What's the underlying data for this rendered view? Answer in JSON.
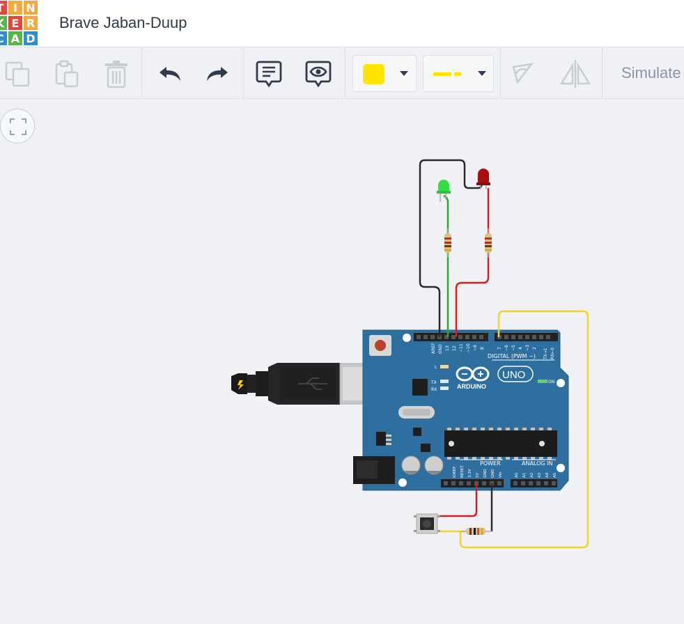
{
  "app": {
    "logo_letters": [
      "T",
      "I",
      "N",
      "K",
      "E",
      "R",
      "C",
      "A",
      "D"
    ],
    "logo_colors": [
      "#e8443a",
      "#f7a83b",
      "#f7a83b",
      "#58b847",
      "#e8443a",
      "#f7a83b",
      "#2c90d0",
      "#58b847",
      "#2c90d0"
    ],
    "project_title": "Brave Jaban-Duup"
  },
  "toolbar": {
    "copy_icon": "copy-icon",
    "paste_icon": "paste-icon",
    "delete_icon": "trash-icon",
    "undo_icon": "undo-icon",
    "redo_icon": "redo-icon",
    "notes_icon": "notes-icon",
    "show_notes_icon": "eye-comment-icon",
    "color_value": "#ffe500",
    "line_style": "dashed",
    "rotate_icon": "rotate-icon",
    "mirror_icon": "mirror-icon",
    "simulate_label": "Simulate"
  },
  "canvas": {
    "fit_icon": "fit-view-icon",
    "board": {
      "brand": "ARDUINO",
      "model": "UNO",
      "digital_label": "DIGITAL (PWM ~)",
      "power_label": "POWER",
      "analog_label": "ANALOG IN",
      "on_label": "ON",
      "l_label": "L",
      "tx_label": "TX",
      "rx_label": "RX",
      "digital_pins": [
        "AREF",
        "GND",
        "13",
        "12",
        "~11",
        "~10",
        "~9",
        "8",
        "7",
        "~6",
        "~5",
        "4",
        "~3",
        "2",
        "TX→1",
        "RX←0"
      ],
      "power_pins": [
        "IOREF",
        "RESET",
        "3.3V",
        "5V",
        "GND",
        "GND",
        "Vin"
      ],
      "analog_pins": [
        "A0",
        "A1",
        "A2",
        "A3",
        "A4",
        "A5"
      ]
    },
    "components": {
      "led_green_color": "#33dd44",
      "led_red_color": "#a81010",
      "wire_colors": {
        "black": "#2a2a2a",
        "green": "#2fa82f",
        "red": "#d21f1f",
        "yellow": "#f2d32e"
      }
    }
  }
}
